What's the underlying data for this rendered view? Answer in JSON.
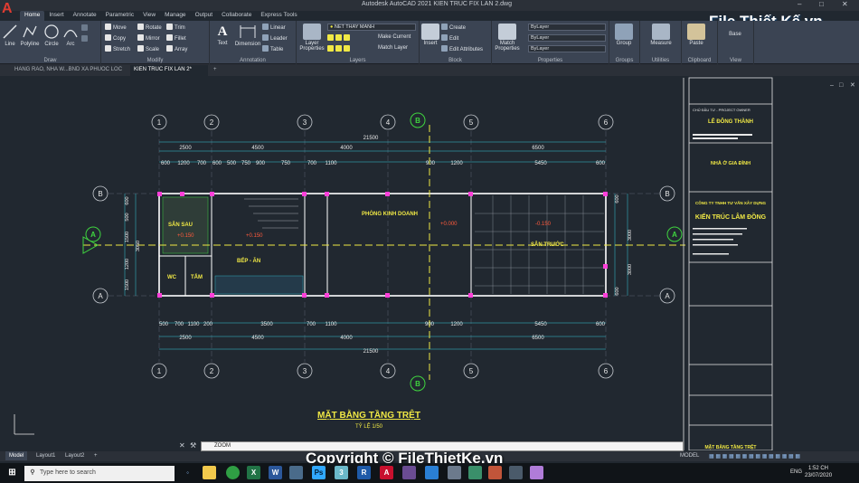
{
  "app": {
    "title": "Autodesk AutoCAD 2021   KIEN TRUC FIX LAN 2.dwg",
    "logo": "A",
    "watermark_logo": "File Thiết Kế.vn"
  },
  "ribbon_tabs": [
    "Home",
    "Insert",
    "Annotate",
    "Parametric",
    "View",
    "Manage",
    "Output",
    "Collaborate",
    "Express Tools"
  ],
  "ribbon": {
    "draw": {
      "title": "Draw",
      "line": "Line",
      "polyline": "Polyline",
      "circle": "Circle",
      "arc": "Arc"
    },
    "modify": {
      "title": "Modify",
      "move": "Move",
      "rotate": "Rotate",
      "trim": "Trim",
      "copy": "Copy",
      "mirror": "Mirror",
      "fillet": "Fillet",
      "stretch": "Stretch",
      "scale": "Scale",
      "array": "Array"
    },
    "annotation": {
      "title": "Annotation",
      "text": "Text",
      "dimension": "Dimension",
      "linear": "Linear",
      "leader": "Leader",
      "table": "Table"
    },
    "layers": {
      "title": "Layers",
      "properties": "Layer Properties",
      "current_layer": "NET THAY MANH",
      "make_current": "Make Current",
      "match_layer": "Match Layer"
    },
    "block": {
      "title": "Block",
      "insert": "Insert",
      "create": "Create",
      "edit": "Edit",
      "edit_attributes": "Edit Attributes"
    },
    "properties": {
      "title": "Properties",
      "match": "Match Properties",
      "bylayer1": "ByLayer",
      "bylayer2": "ByLayer",
      "bylayer3": "ByLayer"
    },
    "groups": {
      "title": "Groups",
      "group": "Group"
    },
    "utilities": {
      "title": "Utilities",
      "measure": "Measure"
    },
    "clipboard": {
      "title": "Clipboard",
      "paste": "Paste"
    },
    "view": {
      "title": "View",
      "base": "Base"
    }
  },
  "doc_tabs": [
    "HANG RAO, NHA W...BND XA PHUOC LOC",
    "KIEN TRUC FIX LAN 2*"
  ],
  "drawing": {
    "title": "MẶT BẰNG TẦNG TRỆT",
    "scale": "TỶ LỆ 1/50",
    "grid_labels_top": [
      "1",
      "2",
      "3",
      "4",
      "5",
      "6"
    ],
    "row_labels": [
      "B",
      "A"
    ],
    "dims_top": [
      "2500",
      "4500",
      "4000",
      "6500"
    ],
    "dims_top_sub": [
      "600",
      "1200",
      "700",
      "600",
      "500",
      "750",
      "900",
      "750",
      "700",
      "1100",
      "900",
      "1200",
      "5450",
      "600"
    ],
    "total": "21500",
    "dims_bottom_sub": [
      "500",
      "700",
      "1100",
      "200",
      "3500",
      "700",
      "1100",
      "900",
      "1200",
      "5450",
      "600"
    ],
    "dims_bottom": [
      "2500",
      "4500",
      "4000",
      "6500"
    ],
    "rooms": [
      "SÂN SAU",
      "PHÒNG KINH DOANH",
      "BẾP - ĂN",
      "SÂN TRƯỚC",
      "WC",
      "TẮM"
    ],
    "levels": [
      "+0.150",
      "+0.150",
      "+0.000",
      "-0.150"
    ],
    "side_dims": [
      "3000",
      "3000",
      "1500",
      "600",
      "3000",
      "600"
    ],
    "side_left": [
      "600",
      "500",
      "1500",
      "3050",
      "1200",
      "1500"
    ]
  },
  "titleblock": {
    "owner_label": "CHỦ ĐẦU TƯ - PROJECT OWNER",
    "owner": "LÊ ĐÔNG THÀNH",
    "project": "NHÀ Ở GIA ĐÌNH",
    "company": "CÔNG TY TNHH TƯ VẤN XÂY DỰNG",
    "company_name": "KIẾN TRÚC LÂM ĐỒNG",
    "sheet_title": "MẶT BẰNG TẦNG TRỆT"
  },
  "command": {
    "placeholder": "ZOOM"
  },
  "layout_tabs": [
    "Model",
    "Layout1",
    "Layout2"
  ],
  "status": {
    "model": "MODEL",
    "lang": "ENG",
    "time": "1:52 CH",
    "date": "23/07/2020"
  },
  "taskbar": {
    "search": "Type here to search"
  },
  "watermark": "Copyright © FileThietKe.vn",
  "colors": {
    "cyan": "#35c6d8",
    "yellow": "#f0e845",
    "magenta": "#ff3fd9",
    "green": "#3fd43f",
    "white": "#e8e8e8"
  }
}
